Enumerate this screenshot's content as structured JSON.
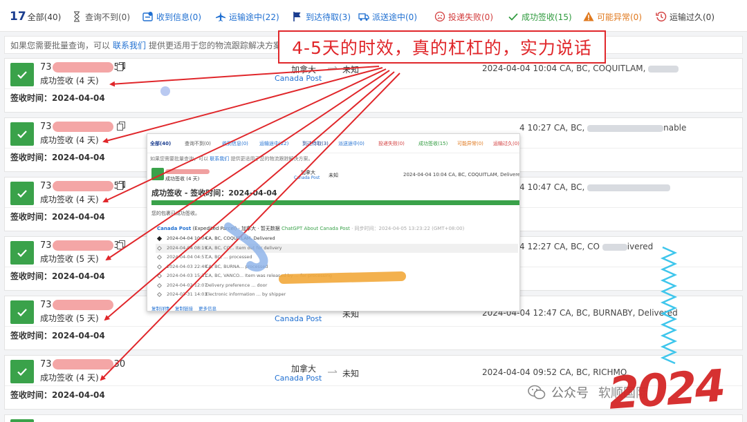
{
  "tabs": [
    {
      "label": "全部(40)",
      "icon": "logo-17-icon"
    },
    {
      "label": "查询不到(0)",
      "icon": "hourglass-icon"
    },
    {
      "label": "收到信息(0)",
      "icon": "info-received-icon"
    },
    {
      "label": "运输途中(22)",
      "icon": "airplane-icon"
    },
    {
      "label": "到达待取(3)",
      "icon": "flag-icon"
    },
    {
      "label": "派送途中(0)",
      "icon": "truck-icon"
    },
    {
      "label": "投递失败(0)",
      "icon": "sad-face-icon"
    },
    {
      "label": "成功签收(15)",
      "icon": "checkmark-icon"
    },
    {
      "label": "可能异常(0)",
      "icon": "warning-icon"
    },
    {
      "label": "运输过久(0)",
      "icon": "clock-history-icon"
    }
  ],
  "tab_logo": "17",
  "notice": {
    "prefix": "如果您需要批量查询，可以",
    "link": "联系我们",
    "suffix": "提供更适用于您的物流跟踪解决方案。"
  },
  "callout": "4-5天的时效，真的杠杠的，实力说话",
  "cards": [
    {
      "num_prefix": "73",
      "num_suffix": "54",
      "status": "成功签收 (4 天)",
      "country": "加拿大",
      "carrier": "Canada Post",
      "dest": "未知",
      "latest": "2024-04-04 10:04  CA, BC, COQUITLAM,",
      "signed": "签收时间：2024-04-04"
    },
    {
      "num_prefix": "73",
      "num_suffix": "",
      "status": "成功签收 (4 天)",
      "country": "",
      "carrier": "",
      "dest": "",
      "latest": "4 10:27  CA, BC,",
      "latest_tail": "nable",
      "signed": "签收时间：2024-04-04"
    },
    {
      "num_prefix": "73",
      "num_suffix": "54",
      "status": "成功签收 (4 天)",
      "country": "",
      "carrier": "",
      "dest": "",
      "latest": "4 10:47  CA, BC,",
      "signed": "签收时间：2024-04-04"
    },
    {
      "num_prefix": "73",
      "num_suffix": "3",
      "status": "成功签收 (5 天)",
      "country": "",
      "carrier": "",
      "dest": "",
      "latest": "4 12:27  CA, BC, CO",
      "latest_tail": "ivered",
      "signed": "签收时间：2024-04-04"
    },
    {
      "num_prefix": "73",
      "num_suffix": "",
      "status": "成功签收 (5 天)",
      "country": "",
      "carrier": "Canada Post",
      "dest": "未知",
      "latest": "2024-04-04 12:47  CA, BC, BURNABY, Delivered",
      "signed": "签收时间：2024-04-04"
    },
    {
      "num_prefix": "73",
      "num_suffix": "30",
      "status": "成功签收 (4 天)",
      "country": "加拿大",
      "carrier": "Canada Post",
      "dest": "未知",
      "latest": "2024-04-04 09:52  CA, BC, RICHMO",
      "signed": "签收时间：2024-04-04"
    }
  ],
  "inset": {
    "tabs": [
      "全部(40)",
      "查询不到(0)",
      "收到信息(0)",
      "运输途中(22)",
      "到达待取(3)",
      "派送途中(0)",
      "投递失败(0)",
      "成功签收(15)",
      "可能异常(0)",
      "运输过久(0)"
    ],
    "notice_prefix": "如果您需要批量查询，可以",
    "notice_link": "联系我们",
    "notice_suffix": "提供更适用于您的物流跟踪解决方案。",
    "status": "成功签收 (4 天)",
    "country": "加拿大",
    "carrier": "Canada Post",
    "dest": "未知",
    "latest": "2024-04-04 10:04  CA, BC, COQUITLAM, Delivered",
    "heading": "成功签收 - 签收时间：2024-04-04",
    "message": "您的包裹已成功签收。",
    "carrier_line_name": "Canada Post",
    "carrier_line_mid": "(Expedited Parcel) · 加拿大 · 暂无数据",
    "carrier_line_ai": "ChatGPT About Canada Post",
    "carrier_line_time": "· 同步时间：2024-04-05 13:23:22 (GMT+08:00)",
    "events": [
      {
        "date": "2024-04-04 10:04",
        "text": "CA, BC, COQUITLAM, Delivered"
      },
      {
        "date": "2024-04-04 08:19",
        "text": "CA, BC, CO... Item out for delivery"
      },
      {
        "date": "2024-04-04 04:57",
        "text": "CA, BC, ... processed"
      },
      {
        "date": "2024-04-03 22:40",
        "text": "CA, BC, BURNA... processed"
      },
      {
        "date": "2024-04-03 15:31",
        "text": "CA, BC, VANCO... Item was released by ... for processing"
      },
      {
        "date": "2024-04-02 12:07",
        "text": "Delivery preference ... door"
      },
      {
        "date": "2024-03-31 14:03",
        "text": "Electronic information ... by shipper"
      }
    ],
    "footer": [
      "复制详情",
      "复制链接",
      "更多信息"
    ]
  },
  "watermark": {
    "wechat_label": "公众号",
    "account": "软顺国际",
    "stamp": "2024"
  },
  "colors": {
    "accent": "#1f6fd1",
    "success": "#3aa24a",
    "callout": "#e0262a",
    "warning": "#e0791e",
    "failure": "#d23b3b"
  }
}
